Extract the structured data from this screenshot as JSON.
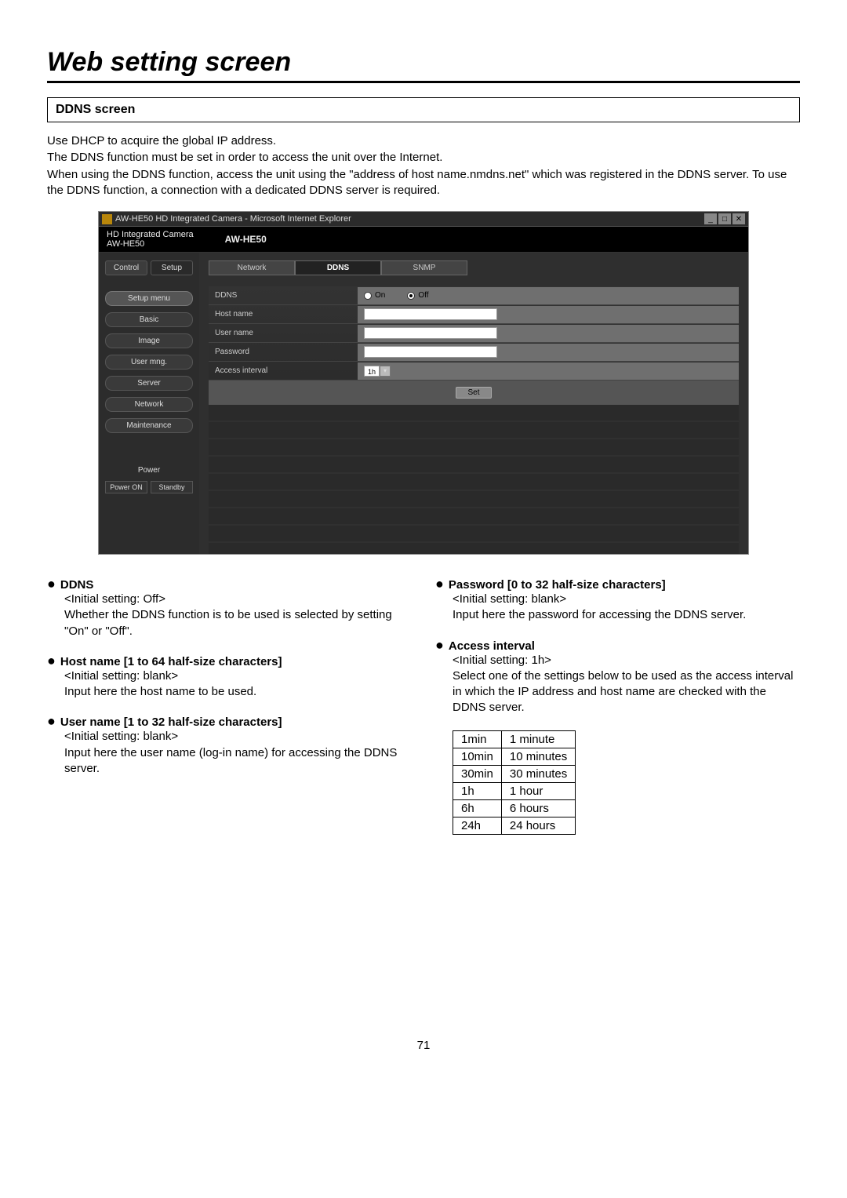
{
  "page_title": "Web setting screen",
  "section_heading": "DDNS screen",
  "intro_lines": [
    "Use DHCP to acquire the global IP address.",
    "The DDNS function must be set in order to access the unit over the Internet.",
    "When using the DDNS function, access the unit using the \"address of host name.nmdns.net\" which was registered in the DDNS server. To use the DDNS function, a connection with a dedicated DDNS server is required."
  ],
  "screenshot": {
    "titlebar": "AW-HE50 HD Integrated Camera - Microsoft Internet Explorer",
    "header_line1": "HD Integrated Camera",
    "header_line2": "AW-HE50",
    "model": "AW-HE50",
    "side_tabs": {
      "control": "Control",
      "setup": "Setup"
    },
    "side_category": "Setup menu",
    "side_items": [
      "Basic",
      "Image",
      "User mng.",
      "Server",
      "Network",
      "Maintenance"
    ],
    "power_label": "Power",
    "power_on": "Power ON",
    "power_standby": "Standby",
    "tabs": [
      "Network",
      "DDNS",
      "SNMP"
    ],
    "active_tab": "DDNS",
    "rows": {
      "ddns": "DDNS",
      "on": "On",
      "off": "Off",
      "hostname": "Host name",
      "username": "User name",
      "password": "Password",
      "access_interval": "Access interval",
      "interval_value": "1h"
    },
    "set_btn": "Set",
    "win_min": "_",
    "win_max": "□",
    "win_close": "✕"
  },
  "left_col": [
    {
      "title": "DDNS",
      "lines": [
        "<Initial setting: Off>",
        "Whether the DDNS function is to be used is selected by setting \"On\" or \"Off\"."
      ]
    },
    {
      "title": "Host name [1 to 64 half-size characters]",
      "lines": [
        "<Initial setting: blank>",
        "Input here the host name to be used."
      ]
    },
    {
      "title": "User name [1 to 32 half-size characters]",
      "lines": [
        "<Initial setting: blank>",
        "Input here the user name (log-in name) for accessing the DDNS server."
      ]
    }
  ],
  "right_col": [
    {
      "title": "Password [0 to 32 half-size characters]",
      "lines": [
        "<Initial setting: blank>",
        "Input here the password for accessing the DDNS server."
      ]
    },
    {
      "title": "Access interval",
      "lines": [
        "<Initial setting: 1h>",
        "Select one of the settings below to be used as the access interval in which the IP address and host name are checked with the DDNS server."
      ]
    }
  ],
  "interval_table": [
    [
      "1min",
      "1 minute"
    ],
    [
      "10min",
      "10 minutes"
    ],
    [
      "30min",
      "30 minutes"
    ],
    [
      "1h",
      "1 hour"
    ],
    [
      "6h",
      "6 hours"
    ],
    [
      "24h",
      "24 hours"
    ]
  ],
  "page_number": "71"
}
